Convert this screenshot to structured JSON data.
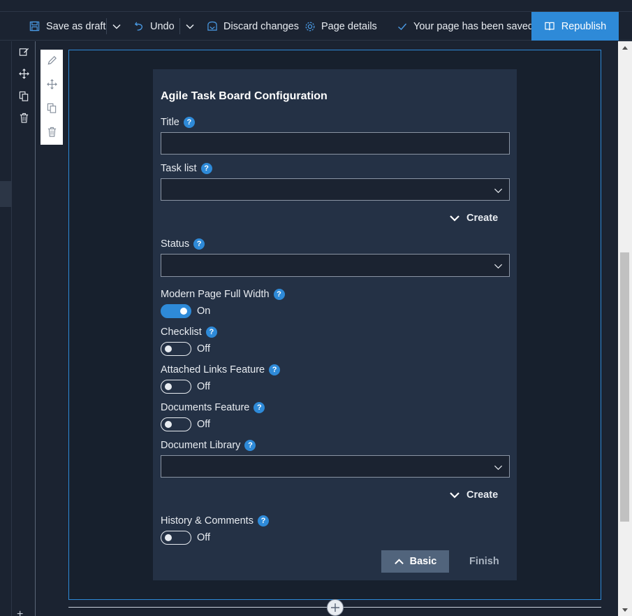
{
  "command_bar": {
    "save_as_draft": "Save as draft",
    "undo": "Undo",
    "discard_changes": "Discard changes",
    "page_details": "Page details",
    "status": "Your page has been saved",
    "republish": "Republish"
  },
  "panel": {
    "title": "Agile Task Board Configuration",
    "help_glyph": "?",
    "fields": {
      "title": {
        "label": "Title",
        "value": ""
      },
      "task_list": {
        "label": "Task list",
        "value": "",
        "create": "Create"
      },
      "status": {
        "label": "Status",
        "value": ""
      },
      "modern_page_full_width": {
        "label": "Modern Page Full Width",
        "state": "On",
        "on": true
      },
      "checklist": {
        "label": "Checklist",
        "state": "Off",
        "on": false
      },
      "attached_links": {
        "label": "Attached Links Feature",
        "state": "Off",
        "on": false
      },
      "documents": {
        "label": "Documents Feature",
        "state": "Off",
        "on": false
      },
      "document_library": {
        "label": "Document Library",
        "value": "",
        "create": "Create"
      },
      "history_comments": {
        "label": "History & Comments",
        "state": "Off",
        "on": false
      }
    },
    "buttons": {
      "basic": "Basic",
      "finish": "Finish"
    }
  },
  "colors": {
    "accent": "#2e8ad8",
    "panel_bg": "#243145",
    "page_bg": "#1b2331",
    "basic_button": "#51647c"
  }
}
